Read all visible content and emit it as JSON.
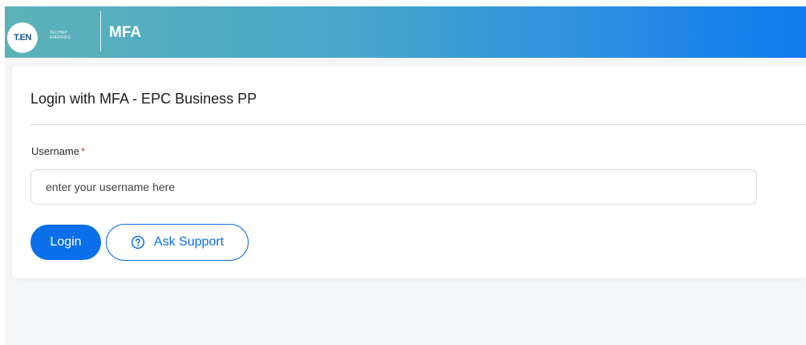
{
  "header": {
    "logo_text": "T.EN",
    "logo_sub_line1": "TECHNIP",
    "logo_sub_line2": "ENERGIES",
    "title": "MFA"
  },
  "card": {
    "title": "Login with MFA - EPC Business PP",
    "username_label": "Username",
    "required_mark": "*",
    "username_placeholder": "enter your username here",
    "username_value": ""
  },
  "actions": {
    "login_label": "Login",
    "support_label": "Ask Support",
    "support_icon": "question-circle-icon"
  },
  "colors": {
    "primary": "#0a6fe8",
    "header_start": "#5db2b8",
    "header_end": "#0f79ee",
    "required": "#e23c3c"
  }
}
